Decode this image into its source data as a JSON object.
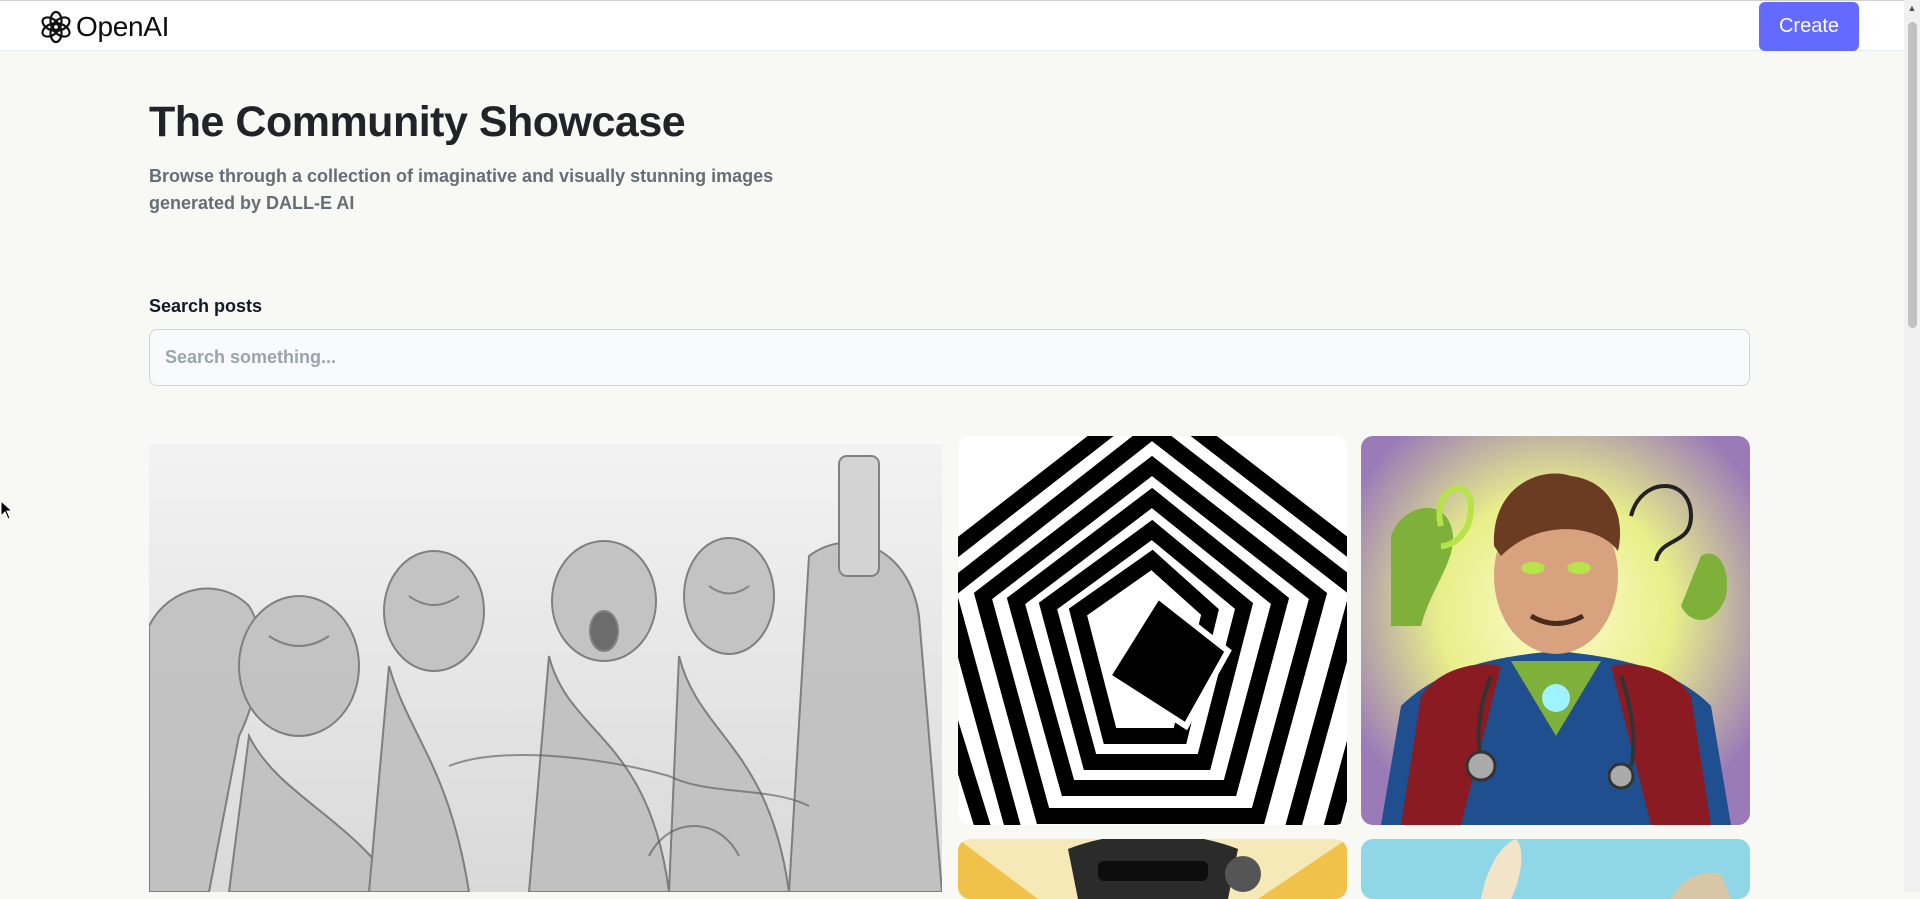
{
  "header": {
    "logo_text": "OpenAI",
    "create_label": "Create",
    "accent_color": "#6469ff"
  },
  "hero": {
    "title": "The Community Showcase",
    "subtitle": "Browse through a collection of imaginative and visually stunning images generated by DALL-E AI"
  },
  "search": {
    "label": "Search posts",
    "placeholder": "Search something...",
    "value": ""
  },
  "gallery": {
    "cards": [
      {
        "name": "pencil-sketch-supper-image"
      },
      {
        "name": "op-art-stripes-image"
      },
      {
        "name": "green-superhero-doctor-image"
      },
      {
        "name": "comic-sunglasses-image"
      },
      {
        "name": "cartoon-animal-ear-image"
      }
    ]
  }
}
